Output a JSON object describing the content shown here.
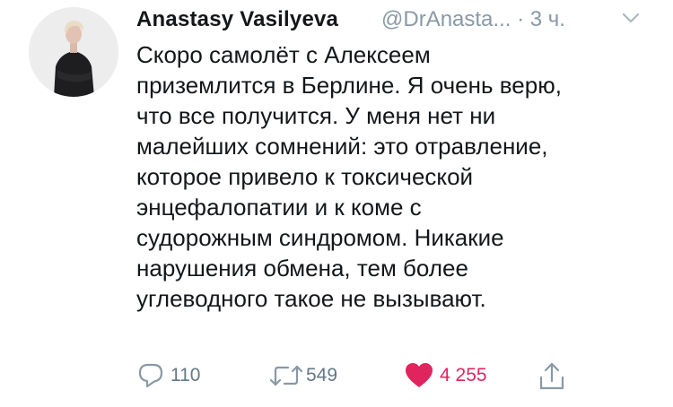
{
  "tweet": {
    "author": {
      "name": "Anastasy Vasilyeva",
      "handle": "@DrAnasta...",
      "time": "· 3 ч."
    },
    "lines": [
      "Скоро самолёт с Алексеем",
      "приземлится в Берлине. Я очень верю,",
      "что все получится. У меня нет ни",
      "малейших сомнений: это отравление,",
      "которое привело к токсической",
      "энцефалопатии и к коме с",
      "судорожным синдромом. Никакие",
      "нарушения обмена, тем более",
      "углеводного такое не вызывают."
    ],
    "actions": {
      "replies": "110",
      "retweets": "549",
      "likes": "4 255"
    },
    "icons": {
      "reply": "reply-icon",
      "retweet": "retweet-icon",
      "like": "heart-icon",
      "share": "share-icon",
      "menu": "chevron-down-icon"
    },
    "colors": {
      "like": "#e0245e",
      "muted": "#8899a6",
      "text": "#14171a"
    }
  }
}
